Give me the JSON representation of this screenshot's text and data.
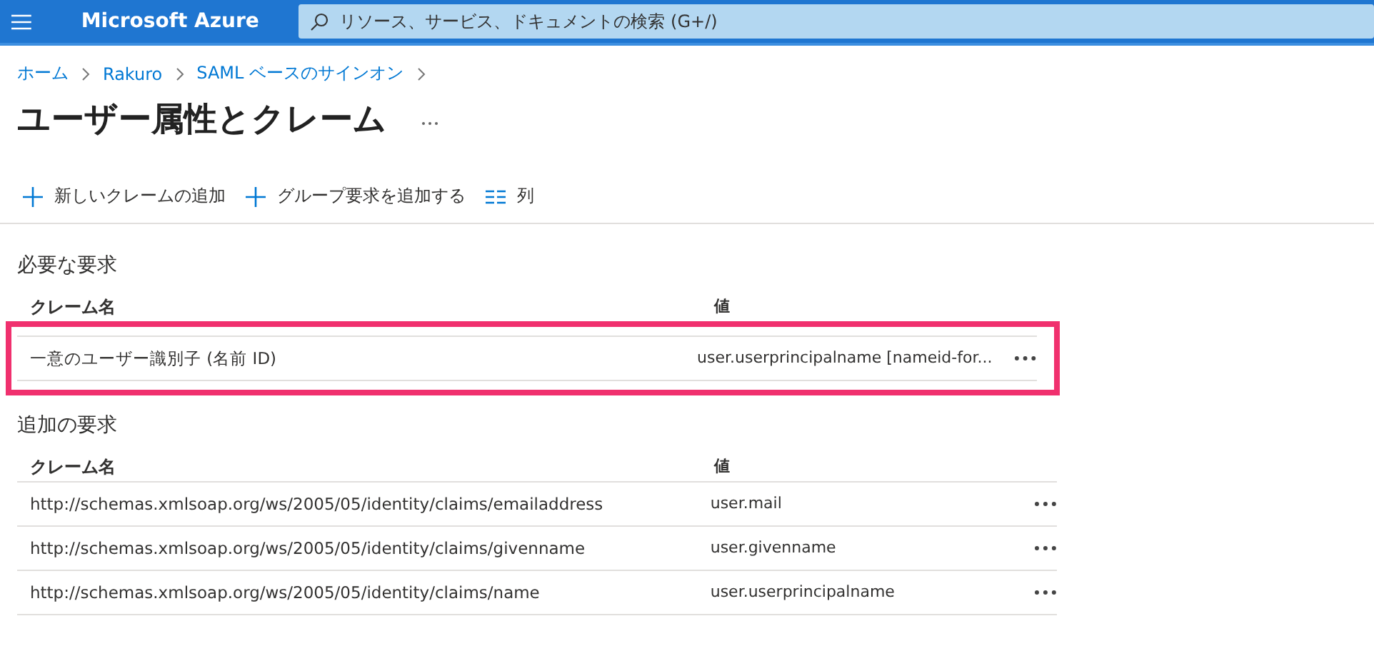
{
  "top_bar": {
    "brand": "Microsoft Azure",
    "search": {
      "placeholder": "リソース、サービス、ドキュメントの検索 (G+/)"
    }
  },
  "breadcrumb": [
    "ホーム",
    "Rakuro",
    "SAML ベースのサインオン"
  ],
  "title": "ユーザー属性とクレーム",
  "toolbar": [
    {
      "kind": "add",
      "label": "新しいクレームの追加"
    },
    {
      "kind": "add",
      "label": "グループ要求を追加する"
    },
    {
      "kind": "columns",
      "label": "列"
    }
  ],
  "sections": [
    {
      "heading": "必要な要求",
      "highlighted": true,
      "columns": [
        "クレーム名",
        "値"
      ],
      "rows": [
        {
          "name": "一意のユーザー識別子 (名前 ID)",
          "value": "user.userprincipalname [nameid-for..."
        }
      ]
    },
    {
      "heading": "追加の要求",
      "highlighted": false,
      "columns": [
        "クレーム名",
        "値"
      ],
      "rows": [
        {
          "name": "http://schemas.xmlsoap.org/ws/2005/05/identity/claims/emailaddress",
          "value": "user.mail"
        },
        {
          "name": "http://schemas.xmlsoap.org/ws/2005/05/identity/claims/givenname",
          "value": "user.givenname"
        },
        {
          "name": "http://schemas.xmlsoap.org/ws/2005/05/identity/claims/name",
          "value": "user.userprincipalname"
        }
      ]
    }
  ]
}
